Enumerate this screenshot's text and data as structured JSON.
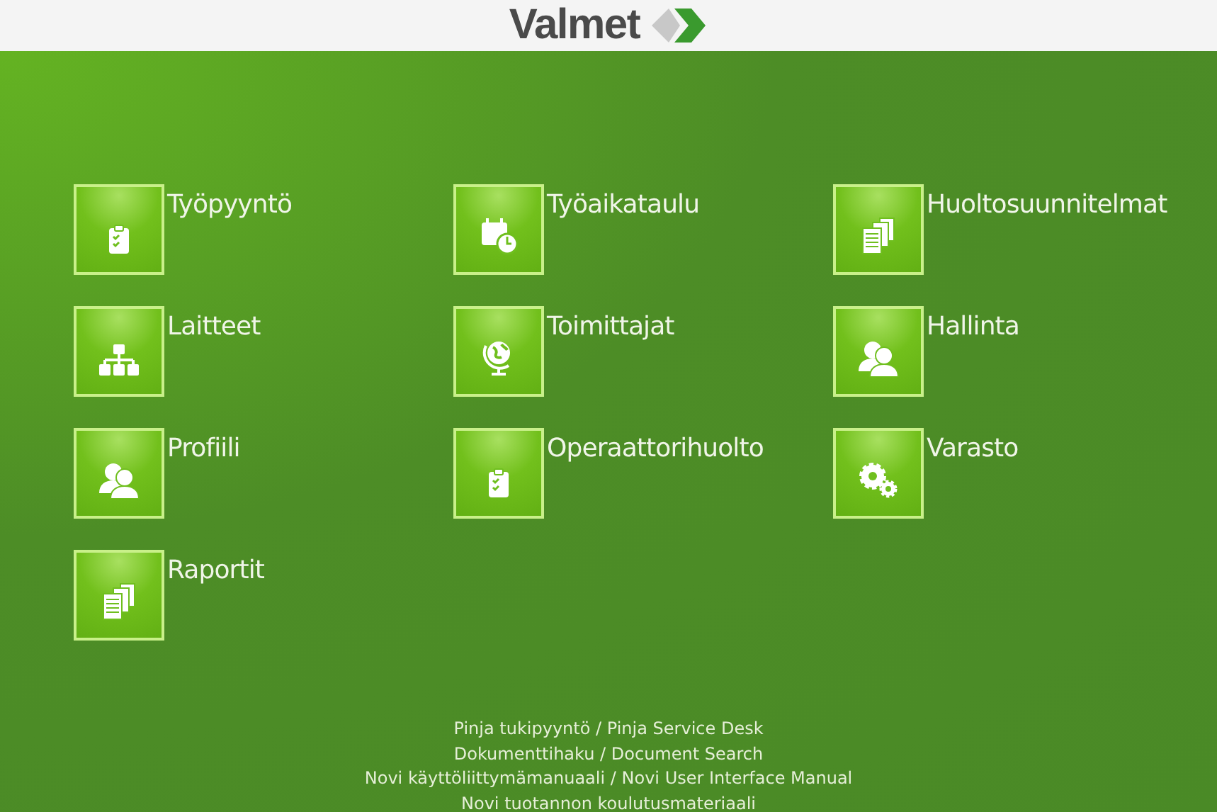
{
  "header": {
    "logo": "Valmet"
  },
  "tiles": [
    {
      "label": "Työpyyntö",
      "kind": "clipboard"
    },
    {
      "label": "Työaikataulu",
      "kind": "calendar"
    },
    {
      "label": "Huoltosuunnitelmat",
      "kind": "documents"
    },
    {
      "label": "Laitteet",
      "kind": "hierarchy"
    },
    {
      "label": "Toimittajat",
      "kind": "globe"
    },
    {
      "label": "Hallinta",
      "kind": "people"
    },
    {
      "label": "Profiili",
      "kind": "people"
    },
    {
      "label": "Operaattorihuolto",
      "kind": "clipboard"
    },
    {
      "label": "Varasto",
      "kind": "gears"
    },
    {
      "label": "Raportit",
      "kind": "documents"
    }
  ],
  "footer_links": [
    "Pinja tukipyyntö / Pinja Service Desk",
    "Dokumenttihaku / Document Search",
    "Novi käyttöliittymämanuaali / Novi User Interface Manual",
    "Novi tuotannon koulutusmateriaali"
  ]
}
